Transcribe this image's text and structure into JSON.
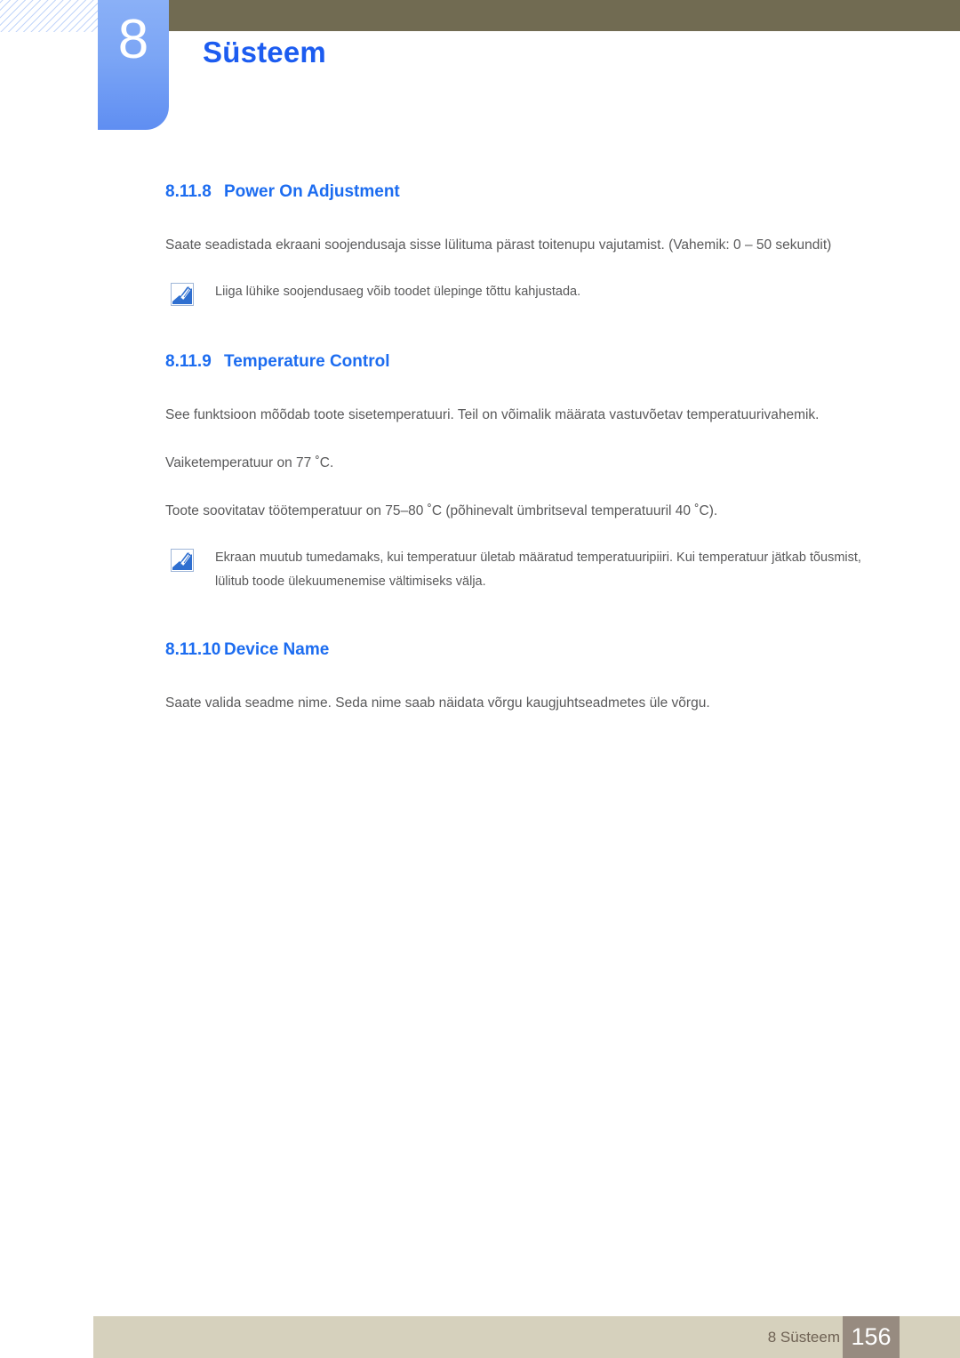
{
  "header": {
    "chapter_number": "8",
    "chapter_title": "Süsteem",
    "accent_color": "#1c5cf0",
    "bar_color": "#716b52",
    "chapter_box_color": "#7ba5f5"
  },
  "sections": [
    {
      "number": "8.11.8",
      "title": "Power On Adjustment",
      "paragraphs": [
        "Saate seadistada ekraani soojendusaja sisse lülituma pärast toitenupu vajutamist. (Vahemik: 0 – 50 sekundit)"
      ],
      "note": {
        "icon": "note-pencil-icon",
        "text": "Liiga lühike soojendusaeg võib toodet ülepinge tõttu kahjustada."
      }
    },
    {
      "number": "8.11.9",
      "title": "Temperature Control",
      "paragraphs": [
        "See funktsioon mõõdab toote sisetemperatuuri. Teil on võimalik määrata vastuvõetav temperatuurivahemik.",
        "Vaiketemperatuur on 77 ˚C.",
        "Toote soovitatav töötemperatuur on 75–80 ˚C (põhinevalt ümbritseval temperatuuril 40 ˚C)."
      ],
      "note": {
        "icon": "note-pencil-icon",
        "text": "Ekraan muutub tumedamaks, kui temperatuur ületab määratud temperatuuripiiri. Kui temperatuur jätkab tõusmist, lülitub toode ülekuumenemise vältimiseks välja."
      }
    },
    {
      "number": "8.11.10",
      "title": "Device Name",
      "paragraphs": [
        "Saate valida seadme nime. Seda nime saab näidata võrgu kaugjuhtseadmetes üle võrgu."
      ]
    }
  ],
  "footer": {
    "label": "8 Süsteem",
    "page_number": "156",
    "bar_color": "#d6d1bd",
    "page_box_color": "#978b80"
  }
}
